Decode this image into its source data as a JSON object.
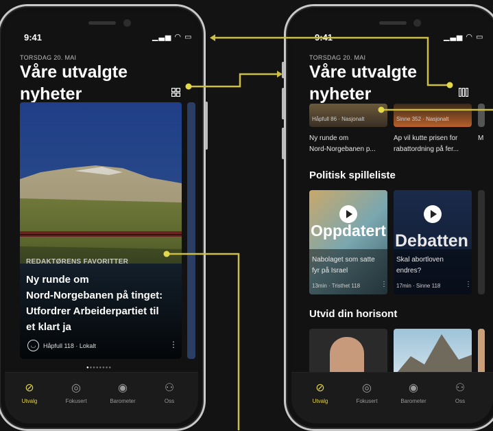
{
  "left": {
    "time": "9:41",
    "status": "▁▃▅ ◠ ▭",
    "date": "TORSDAG 20. MAI",
    "title_line1": "Våre utvalgte",
    "title_line2": "nyheter",
    "featured": {
      "kicker": "REDAKTØRENS FAVORITTER",
      "headline_1": "Ny runde om",
      "headline_2": "Nord-Norgebanen på tinget:",
      "headline_3": "Utfordrer Arbeiderpartiet til",
      "headline_4": "et klart ja",
      "source": "Håpfull 118",
      "category": "Lokalt"
    }
  },
  "right": {
    "time": "9:41",
    "status": "▁▃▅ ◠ ▭",
    "date": "TORSDAG 20. MAI",
    "title_line1": "Våre utvalgte",
    "title_line2": "nyheter",
    "top_cards": [
      {
        "meta": "Håpfull 86 · Nasjonalt",
        "line1": "Ny runde om",
        "line2": "Nord-Norgebanen p..."
      },
      {
        "meta": "Sinne 352 · Nasjonalt",
        "line1": "Ap vil kutte prisen for",
        "line2": "rabattordning på fer..."
      },
      {
        "line1": "M"
      }
    ],
    "section1": "Politisk spilleliste",
    "podcasts": [
      {
        "brand": "Oppdatert",
        "line1": "Nabolaget som satte",
        "line2": "fyr på Israel",
        "meta": "13min · Tristhet 118"
      },
      {
        "brand": "Debatten",
        "line1": "Skal abortloven",
        "line2": "endres?",
        "meta": "17min · Sinne 118"
      }
    ],
    "section2": "Utvid din horisont"
  },
  "tabs": [
    {
      "label": "Utvalg",
      "icon": "compass-icon",
      "active": true
    },
    {
      "label": "Fokusert",
      "icon": "target-icon",
      "active": false
    },
    {
      "label": "Barometer",
      "icon": "eye-icon",
      "active": false
    },
    {
      "label": "Oss",
      "icon": "people-icon",
      "active": false
    }
  ],
  "colors": {
    "accent": "#e3d44c",
    "background": "#121212"
  }
}
